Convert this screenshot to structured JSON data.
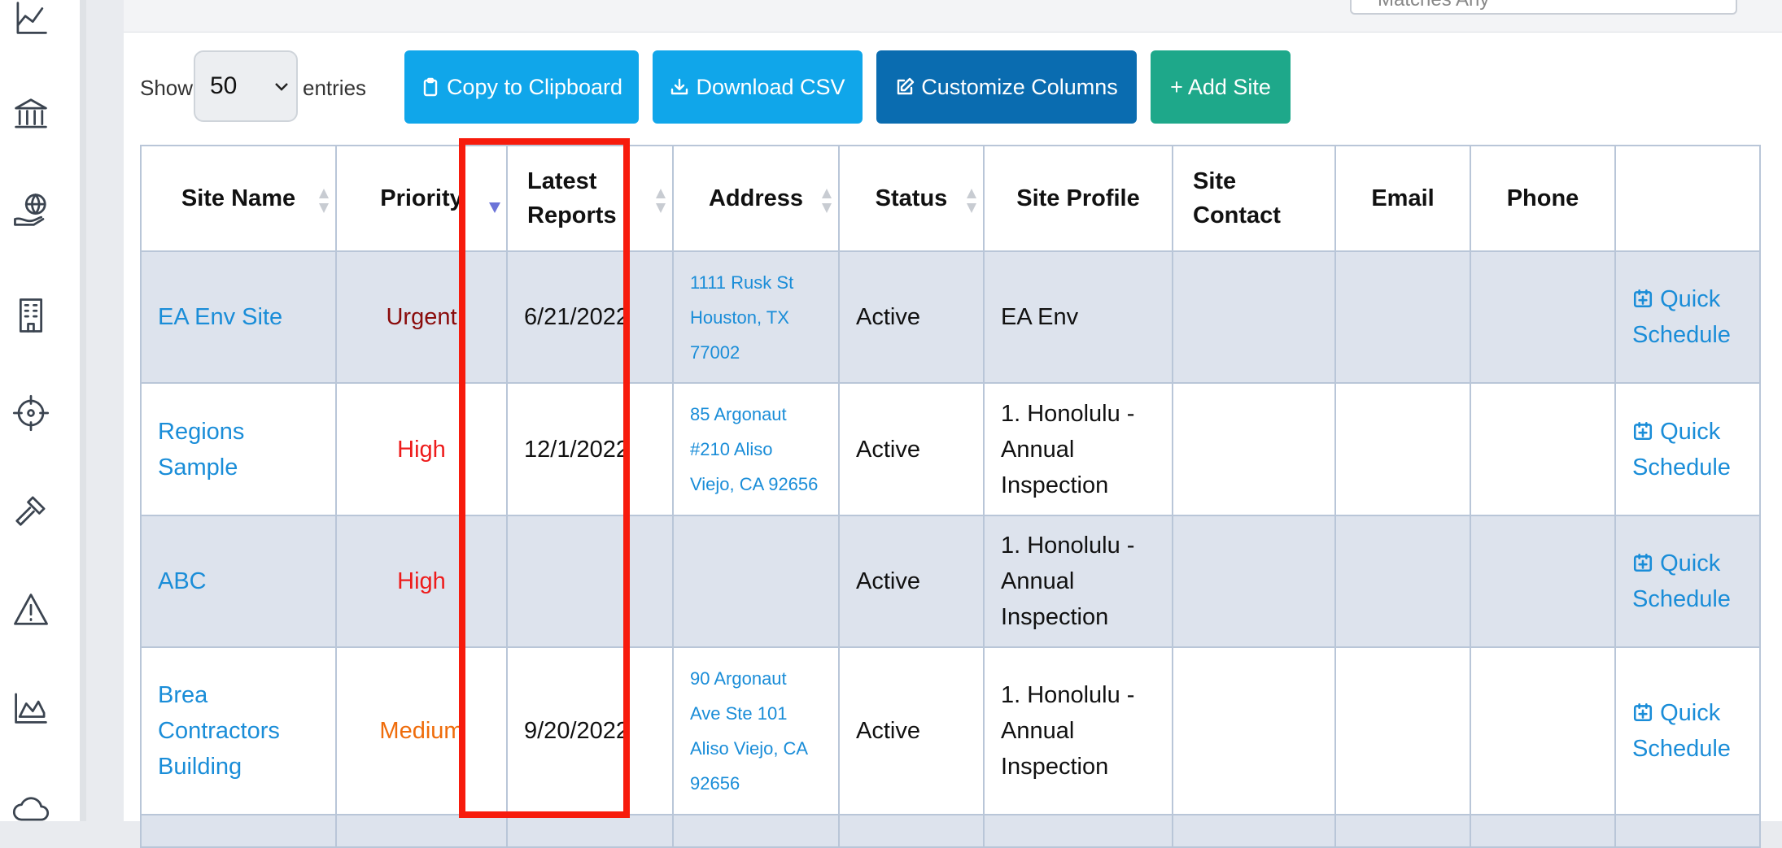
{
  "sidebar": {
    "icons": [
      "chart-line-icon",
      "bank-icon",
      "globe-hand-icon",
      "building-icon",
      "crosshair-icon",
      "hammer-icon",
      "warning-icon",
      "area-chart-icon",
      "cloud-icon"
    ]
  },
  "filter": {
    "placeholder_partial": "Matches Any"
  },
  "toolbar": {
    "show_label": "Show",
    "entries_value": "50",
    "entries_label": "entries",
    "copy_label": "Copy to Clipboard",
    "csv_label": "Download CSV",
    "columns_label": "Customize Columns",
    "add_label": "+ Add Site"
  },
  "table": {
    "columns": [
      "Site Name",
      "Priority",
      "Latest Reports",
      "Address",
      "Status",
      "Site Profile",
      "Site Contact",
      "Email",
      "Phone",
      ""
    ],
    "rows": [
      {
        "site_name": "EA Env Site",
        "priority": "Urgent",
        "latest_reports": "6/21/2022",
        "address": [
          "1111 Rusk St",
          "Houston, TX",
          "77002"
        ],
        "status": "Active",
        "site_profile": "EA Env",
        "site_contact": "",
        "email": "",
        "phone": "",
        "action_1": "Quick",
        "action_2": "Schedule"
      },
      {
        "site_name": "Regions Sample",
        "priority": "High",
        "latest_reports": "12/1/2022",
        "address": [
          "85 Argonaut",
          "#210 Aliso",
          "Viejo, CA 92656"
        ],
        "status": "Active",
        "site_profile": "1. Honolulu - Annual Inspection",
        "site_contact": "",
        "email": "",
        "phone": "",
        "action_1": "Quick",
        "action_2": "Schedule"
      },
      {
        "site_name": "ABC",
        "priority": "High",
        "latest_reports": "",
        "address": [
          "",
          "",
          ""
        ],
        "status": "Active",
        "site_profile": "1. Honolulu - Annual Inspection",
        "site_contact": "",
        "email": "",
        "phone": "",
        "action_1": "Quick",
        "action_2": "Schedule"
      },
      {
        "site_name": "Brea Contractors Building",
        "priority": "Medium",
        "latest_reports": "9/20/2022",
        "address": [
          "90 Argonaut",
          "Ave Ste 101",
          "Aliso Viejo, CA",
          "92656"
        ],
        "status": "Active",
        "site_profile": "1. Honolulu - Annual Inspection",
        "site_contact": "",
        "email": "",
        "phone": "",
        "action_1": "Quick",
        "action_2": "Schedule"
      }
    ]
  },
  "colors": {
    "priority_urgent": "#8a0b0b",
    "priority_high": "#ee1b1b",
    "priority_medium": "#ef6c0b",
    "highlight": "#f71b0c",
    "link": "#1a8dd8"
  }
}
